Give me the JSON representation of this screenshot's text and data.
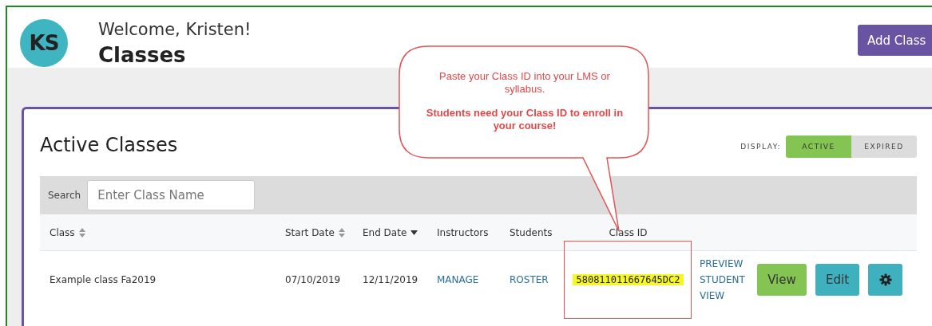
{
  "user": {
    "initials": "KS",
    "greeting": "Welcome, Kristen!"
  },
  "page_title": "Classes",
  "add_button": "Add Class",
  "card": {
    "title": "Active Classes",
    "display_label": "DISPLAY:",
    "display_options": [
      {
        "label": "ACTIVE",
        "selected": true
      },
      {
        "label": "EXPIRED",
        "selected": false
      }
    ],
    "search": {
      "label": "Search",
      "placeholder": "Enter Class Name"
    },
    "columns": [
      {
        "label": "Class",
        "kind": "sortable"
      },
      {
        "label": "Start Date",
        "kind": "sortable"
      },
      {
        "label": "End Date",
        "kind": "sorted"
      },
      {
        "label": "Instructors",
        "kind": "plain"
      },
      {
        "label": "Students",
        "kind": "plain"
      },
      {
        "label": "Class ID",
        "kind": "plain"
      }
    ],
    "rows": [
      {
        "class": "Example class Fa2019",
        "start": "07/10/2019",
        "end": "12/11/2019",
        "instructors": "MANAGE",
        "students": "ROSTER",
        "class_id": "580811011667645DC2",
        "preview": "PREVIEW STUDENT VIEW",
        "view": "View",
        "edit": "Edit"
      }
    ]
  },
  "callout": {
    "note": "Paste your Class ID into your LMS or syllabus.",
    "emphasis": "Students need your Class ID to enroll in your course!"
  }
}
